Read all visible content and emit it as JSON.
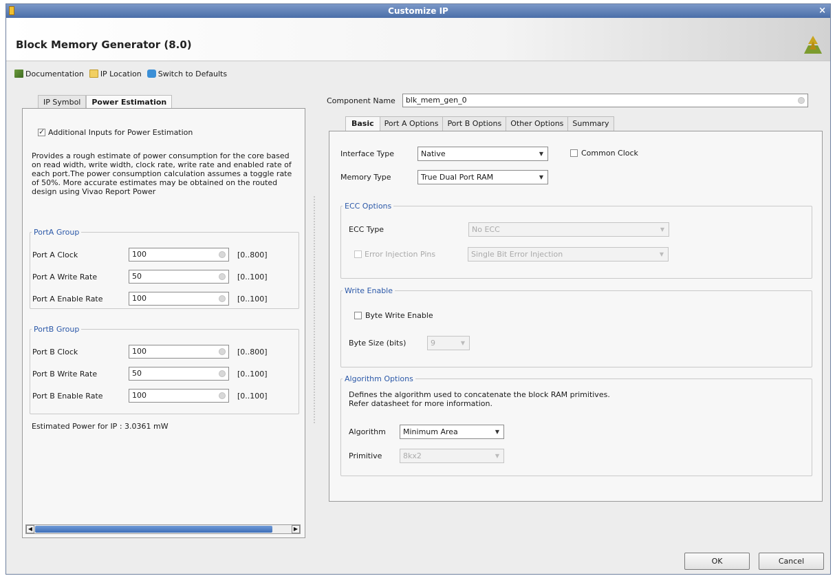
{
  "window": {
    "title": "Customize IP",
    "close_glyph": "×"
  },
  "header": {
    "title": "Block Memory Generator (8.0)",
    "logo_icon": "xilinx-logo-icon"
  },
  "toolbar": {
    "items": [
      {
        "label": "Documentation",
        "icon": "book-icon"
      },
      {
        "label": "IP Location",
        "icon": "folder-icon"
      },
      {
        "label": "Switch to Defaults",
        "icon": "switch-icon"
      }
    ]
  },
  "left": {
    "tabs": [
      "IP Symbol",
      "Power Estimation"
    ],
    "active_tab": "Power Estimation",
    "checkbox_label": "Additional Inputs for Power Estimation",
    "checkbox_checked": true,
    "description": "Provides a rough estimate of power consumption for the core based on read width, write width, clock rate, write rate and enabled rate of each port.The power consumption calculation assumes a toggle rate of 50%. More accurate estimates may be obtained on the routed design using Vivao Report Power",
    "porta": {
      "legend": "PortA Group",
      "rows": [
        {
          "label": "Port A Clock",
          "value": "100",
          "range": "[0..800]"
        },
        {
          "label": "Port A Write Rate",
          "value": "50",
          "range": "[0..100]"
        },
        {
          "label": "Port A Enable Rate",
          "value": "100",
          "range": "[0..100]"
        }
      ]
    },
    "portb": {
      "legend": "PortB Group",
      "rows": [
        {
          "label": "Port B Clock",
          "value": "100",
          "range": "[0..800]"
        },
        {
          "label": "Port B Write Rate",
          "value": "50",
          "range": "[0..100]"
        },
        {
          "label": "Port B Enable Rate",
          "value": "100",
          "range": "[0..100]"
        }
      ]
    },
    "estimated_power": "Estimated Power for IP : 3.0361 mW"
  },
  "right": {
    "component_name_label": "Component Name",
    "component_name_value": "blk_mem_gen_0",
    "tabs": [
      "Basic",
      "Port A Options",
      "Port B Options",
      "Other Options",
      "Summary"
    ],
    "active_tab": "Basic",
    "interface_type_label": "Interface Type",
    "interface_type_value": "Native",
    "common_clock_label": "Common Clock",
    "common_clock_checked": false,
    "memory_type_label": "Memory Type",
    "memory_type_value": "True Dual Port RAM",
    "ecc": {
      "legend": "ECC Options",
      "ecc_type_label": "ECC Type",
      "ecc_type_value": "No ECC",
      "error_injection_label": "Error Injection Pins",
      "error_injection_value": "Single Bit Error Injection"
    },
    "write_enable": {
      "legend": "Write Enable",
      "byte_write_label": "Byte Write Enable",
      "byte_size_label": "Byte Size (bits)",
      "byte_size_value": "9"
    },
    "algorithm": {
      "legend": "Algorithm Options",
      "desc_line1": "Defines the algorithm used to concatenate the block RAM primitives.",
      "desc_line2": "Refer datasheet for more information.",
      "algorithm_label": "Algorithm",
      "algorithm_value": "Minimum Area",
      "primitive_label": "Primitive",
      "primitive_value": "8kx2"
    }
  },
  "buttons": {
    "ok": "OK",
    "cancel": "Cancel"
  }
}
